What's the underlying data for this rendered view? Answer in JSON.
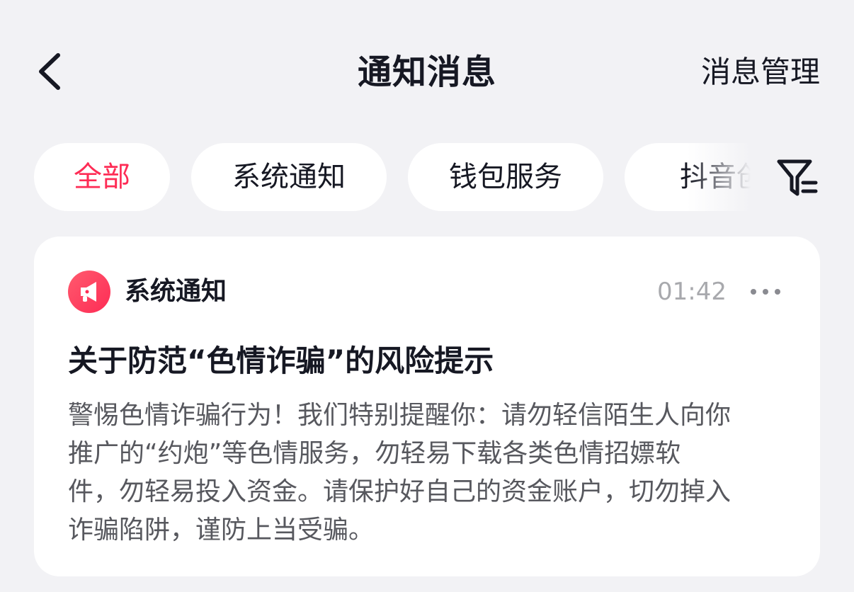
{
  "header": {
    "title": "通知消息",
    "manage_label": "消息管理",
    "back_icon": "chevron-left-icon"
  },
  "tabs": [
    {
      "label": "全部",
      "active": true
    },
    {
      "label": "系统通知",
      "active": false
    },
    {
      "label": "钱包服务",
      "active": false
    },
    {
      "label": "抖音创",
      "active": false
    }
  ],
  "filter_icon": "filter-icon",
  "notification": {
    "sender": "系统通知",
    "icon": "megaphone-icon",
    "time": "01:42",
    "more_icon": "more-icon",
    "title": "关于防范“色情诈骗”的风险提示",
    "body_lines": [
      "警惕色情诈骗行为！我们特别提醒你：请勿轻信陌生人向你",
      "推广的“约炮”等色情服务，勿轻易下载各类色情招嫖软",
      "件，勿轻易投入资金。请保护好自己的资金账户，切勿掉入",
      "诈骗陷阱，谨防上当受骗。"
    ]
  },
  "colors": {
    "accent": "#fe2c55",
    "background": "#f2f2f5",
    "card": "#ffffff",
    "text_primary": "#161823",
    "text_secondary": "#57585e",
    "text_muted": "#a8a9ad"
  }
}
